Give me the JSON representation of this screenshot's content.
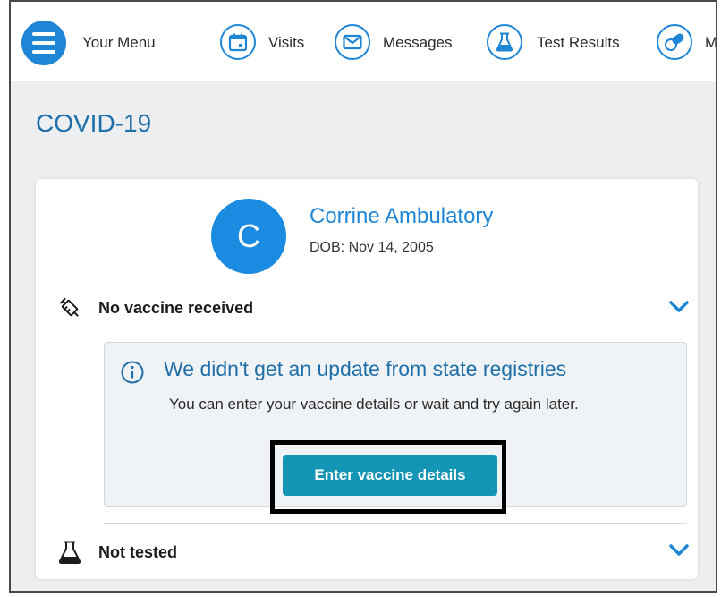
{
  "nav": {
    "menu_label": "Your Menu",
    "items": [
      {
        "label": "Visits",
        "icon": "calendar-icon"
      },
      {
        "label": "Messages",
        "icon": "envelope-icon"
      },
      {
        "label": "Test Results",
        "icon": "flask-icon"
      },
      {
        "label": "M",
        "icon": "pill-icon"
      }
    ],
    "accent_color": "#1f86d6"
  },
  "page": {
    "title": "COVID-19"
  },
  "patient": {
    "initial": "C",
    "name": "Corrine Ambulatory",
    "dob": "DOB: Nov 14, 2005"
  },
  "vaccine": {
    "label": "No vaccine received",
    "info_title": "We didn't get an update from state registries",
    "info_text": "You can enter your vaccine details or wait and try again later.",
    "button_label": "Enter vaccine details"
  },
  "testing": {
    "label": "Not tested"
  }
}
